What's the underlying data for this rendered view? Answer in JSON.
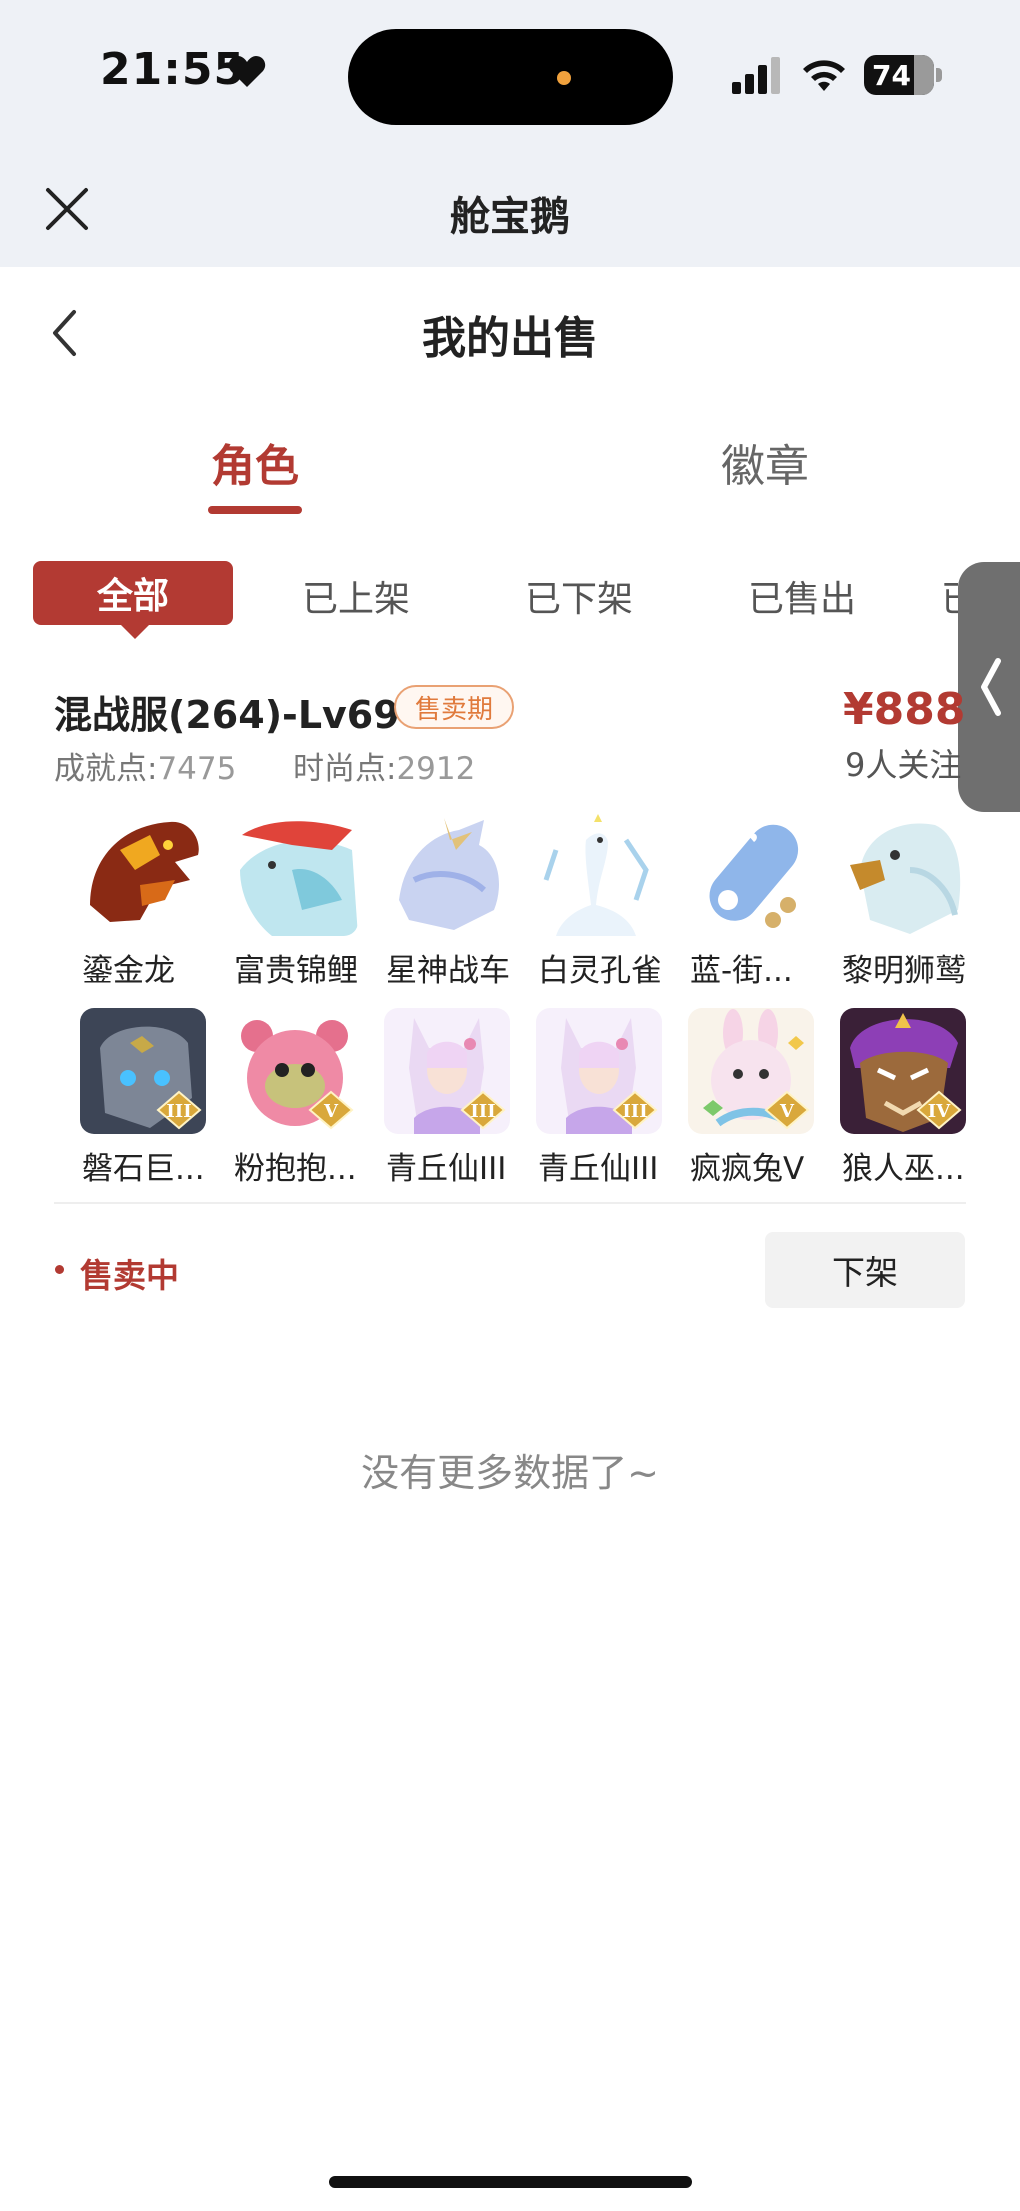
{
  "status_bar": {
    "time": "21:55",
    "battery": "74",
    "island_dot_color": "#f0a13d"
  },
  "app_bar": {
    "title": "舱宝鹅",
    "close_icon": "close-icon"
  },
  "page": {
    "title": "我的出售",
    "back_icon": "chevron-left-icon"
  },
  "tabs": [
    {
      "label": "角色",
      "active": true
    },
    {
      "label": "徽章",
      "active": false
    }
  ],
  "filters": [
    {
      "label": "全部",
      "active": true
    },
    {
      "label": "已上架",
      "active": false
    },
    {
      "label": "已下架",
      "active": false
    },
    {
      "label": "已售出",
      "active": false
    },
    {
      "label": "已",
      "active": false
    }
  ],
  "listing": {
    "title": "混战服(264)-Lv69",
    "badge": "售卖期",
    "price": "¥888",
    "followers": "9人关注",
    "achievement_label": "成就点:",
    "achievement_value": "7475",
    "fashion_label": "时尚点:",
    "fashion_value": "2912",
    "items": [
      {
        "name": "鎏金龙",
        "icon": "golden-dragon-icon",
        "level": ""
      },
      {
        "name": "富贵锦鲤",
        "icon": "koi-fish-icon",
        "level": ""
      },
      {
        "name": "星神战车",
        "icon": "star-chariot-icon",
        "level": ""
      },
      {
        "name": "白灵孔雀",
        "icon": "white-peacock-icon",
        "level": ""
      },
      {
        "name": "蓝-街...",
        "icon": "skateboard-icon",
        "level": ""
      },
      {
        "name": "黎明狮鹫",
        "icon": "griffin-icon",
        "level": ""
      },
      {
        "name": "磐石巨...",
        "icon": "stone-giant-icon",
        "level": "III"
      },
      {
        "name": "粉抱抱...",
        "icon": "pink-bear-icon",
        "level": "V"
      },
      {
        "name": "青丘仙III",
        "icon": "fox-fairy-icon",
        "level": "III"
      },
      {
        "name": "青丘仙III",
        "icon": "fox-fairy-icon",
        "level": "III"
      },
      {
        "name": "疯疯兔V",
        "icon": "crazy-rabbit-icon",
        "level": "V"
      },
      {
        "name": "狼人巫...",
        "icon": "werewolf-icon",
        "level": "IV"
      }
    ],
    "status": "售卖中",
    "action_label": "下架"
  },
  "footer": {
    "no_more": "没有更多数据了~"
  },
  "colors": {
    "accent": "#b23a32",
    "badge": "#e07a3c",
    "topbar_bg": "#eef1f6"
  }
}
